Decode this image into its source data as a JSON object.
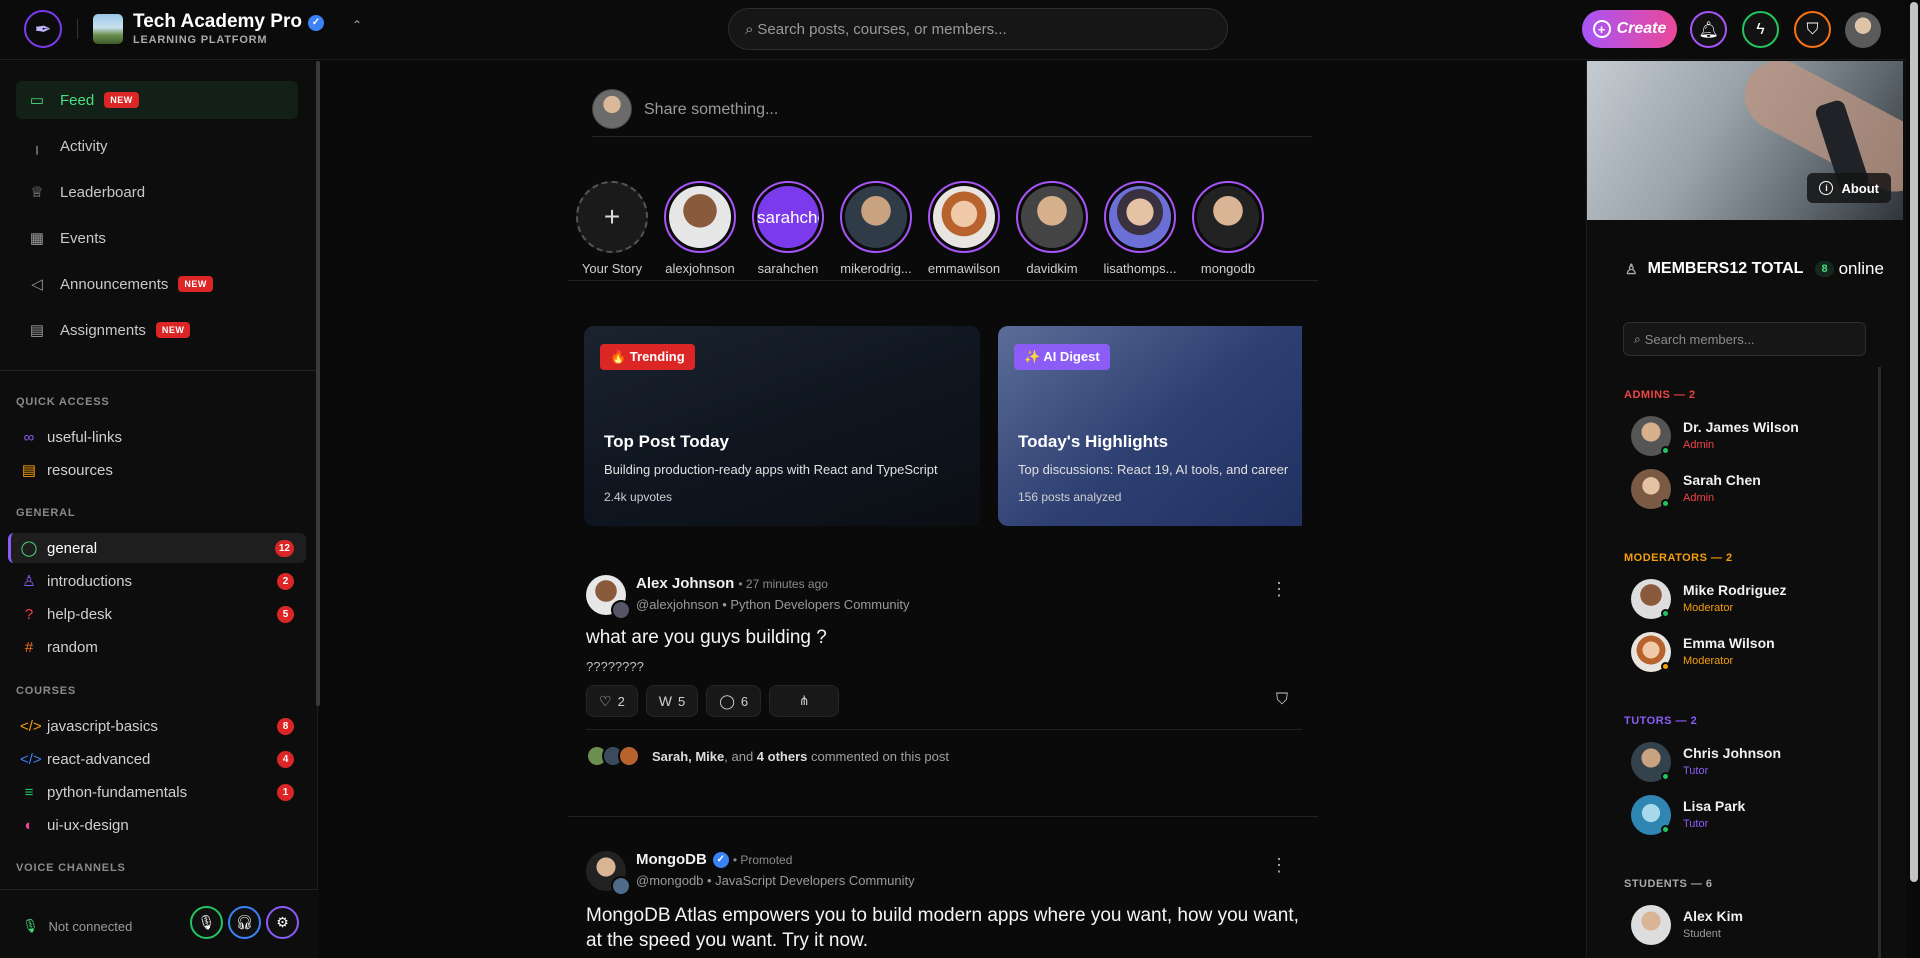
{
  "brand": {
    "title": "Tech Academy Pro",
    "subtitle": "LEARNING PLATFORM"
  },
  "search": {
    "placeholder": "Search posts, courses, or members..."
  },
  "header": {
    "create_label": "Create"
  },
  "colors": {
    "accent": "#a855f7",
    "active_green": "#4ade80",
    "badge_red": "#dc2626",
    "admin": "#ef4444",
    "moderator": "#f59e0b",
    "tutor": "#8b5cf6"
  },
  "sidebar": {
    "nav": [
      {
        "label": "Feed",
        "icon": "message-square-icon",
        "badge": "NEW"
      },
      {
        "label": "Activity",
        "icon": "bar-chart-icon",
        "badge": ""
      },
      {
        "label": "Leaderboard",
        "icon": "trophy-icon",
        "badge": ""
      },
      {
        "label": "Events",
        "icon": "calendar-icon",
        "badge": ""
      },
      {
        "label": "Announcements",
        "icon": "megaphone-icon",
        "badge": "NEW"
      },
      {
        "label": "Assignments",
        "icon": "file-text-icon",
        "badge": "NEW"
      }
    ],
    "quick_access_label": "QUICK ACCESS",
    "quick_access": [
      {
        "label": "useful-links",
        "icon": "link-icon"
      },
      {
        "label": "resources",
        "icon": "document-icon"
      }
    ],
    "general_label": "GENERAL",
    "general": [
      {
        "label": "general",
        "icon": "chat-bubble-icon",
        "count": "12"
      },
      {
        "label": "introductions",
        "icon": "user-icon",
        "count": "2"
      },
      {
        "label": "help-desk",
        "icon": "help-circle-icon",
        "count": "5"
      },
      {
        "label": "random",
        "icon": "hash-icon",
        "count": ""
      }
    ],
    "courses_label": "COURSES",
    "courses": [
      {
        "label": "javascript-basics",
        "icon": "code-icon",
        "count": "8"
      },
      {
        "label": "react-advanced",
        "icon": "code-icon",
        "count": "4"
      },
      {
        "label": "python-fundamentals",
        "icon": "database-icon",
        "count": "1"
      },
      {
        "label": "ui-ux-design",
        "icon": "palette-icon",
        "count": ""
      }
    ],
    "voice_label": "VOICE CHANNELS",
    "voice_status": "Not connected"
  },
  "composer": {
    "placeholder": "Share something..."
  },
  "stories": [
    {
      "name": "Your Story"
    },
    {
      "name": "alexjohnson"
    },
    {
      "name": "sarahchen",
      "overlay_text": "sarahche"
    },
    {
      "name": "mikerodrig..."
    },
    {
      "name": "emmawilson"
    },
    {
      "name": "davidkim"
    },
    {
      "name": "lisathomps..."
    },
    {
      "name": "mongodb"
    }
  ],
  "highlights": [
    {
      "tag": "🔥 Trending",
      "title": "Top Post Today",
      "desc": "Building production-ready apps with React and TypeScript",
      "meta": "2.4k upvotes"
    },
    {
      "tag": "✨ AI Digest",
      "title": "Today's Highlights",
      "desc": "Top discussions: React 19, AI tools, and career",
      "meta": "156 posts analyzed"
    }
  ],
  "posts": [
    {
      "author": "Alex Johnson",
      "time": "• 27 minutes ago",
      "handle": "@alexjohnson • Python Developers Community",
      "title": "what are you guys building ?",
      "body": "????????",
      "likes": "2",
      "upvotes": "5",
      "comments": "6",
      "commenters_names": "Sarah, Mike",
      "commenters_mid": ", and ",
      "commenters_others": "4 others",
      "commenters_tail": " commented on this post"
    },
    {
      "author": "MongoDB",
      "time": "• Promoted",
      "handle": "@mongodb • JavaScript Developers Community",
      "title": "MongoDB Atlas empowers you to build modern apps where you want, how you want, at the speed you want. Try it now."
    }
  ],
  "right": {
    "about_label": "About",
    "members_title": "MEMBERS12 TOTAL",
    "online_count": "8",
    "online_word": "online",
    "search_placeholder": "Search members...",
    "groups": [
      {
        "label": "ADMINS — 2",
        "members": [
          {
            "name": "Dr. James Wilson",
            "role": "Admin"
          },
          {
            "name": "Sarah Chen",
            "role": "Admin"
          }
        ]
      },
      {
        "label": "MODERATORS — 2",
        "members": [
          {
            "name": "Mike Rodriguez",
            "role": "Moderator"
          },
          {
            "name": "Emma Wilson",
            "role": "Moderator"
          }
        ]
      },
      {
        "label": "TUTORS — 2",
        "members": [
          {
            "name": "Chris Johnson",
            "role": "Tutor"
          },
          {
            "name": "Lisa Park",
            "role": "Tutor"
          }
        ]
      },
      {
        "label": "STUDENTS — 6",
        "members": [
          {
            "name": "Alex Kim",
            "role": "Student"
          }
        ]
      }
    ]
  }
}
